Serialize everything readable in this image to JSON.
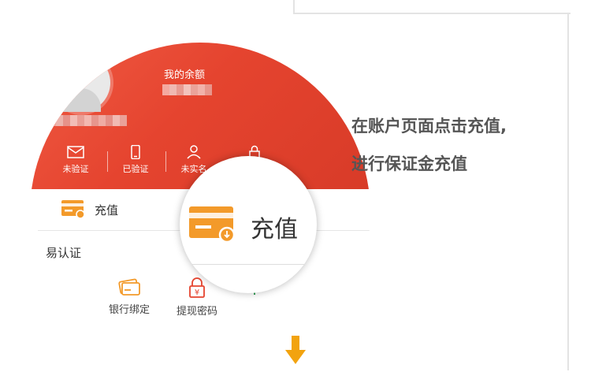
{
  "account_card": {
    "balance_label": "我的余额",
    "status_items": [
      {
        "icon": "envelope-icon",
        "label": "未验证"
      },
      {
        "icon": "phone-icon",
        "label": "已验证"
      },
      {
        "icon": "person-icon",
        "label": "未实名"
      }
    ]
  },
  "menu": {
    "recharge_label": "充值",
    "auth_label": "易认证",
    "grid_items": [
      {
        "icon": "bank-card-icon",
        "label": "银行绑定"
      },
      {
        "icon": "lock-icon",
        "label": "提现密码"
      }
    ]
  },
  "magnifier": {
    "label": "充值"
  },
  "instructions": {
    "line1": "在账户页面点击充值,",
    "line2": "进行保证金充值"
  },
  "colors": {
    "header_red": "#e5442f",
    "accent_orange": "#f39a2a",
    "arrow_yellow": "#f2a30f"
  }
}
